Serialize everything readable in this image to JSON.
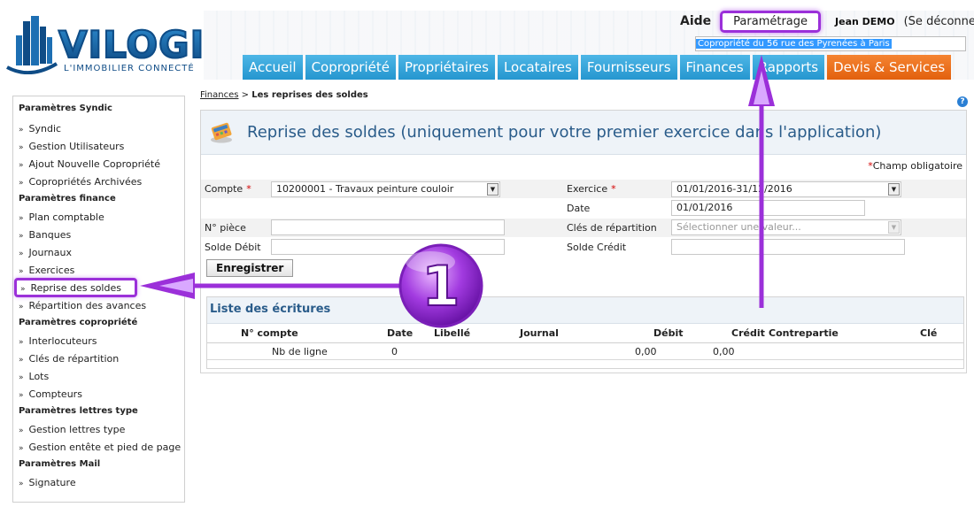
{
  "header": {
    "logo_word": "VILOGI",
    "logo_tagline": "L'IMMOBILIER CONNECTÉ",
    "help_link": "Aide",
    "settings_button": "Paramétrage",
    "user_name": "Jean DEMO",
    "logout_link": "(Se déconnecter)",
    "copro_selected": "Copropriété du 56 rue des Pyrenées à Paris"
  },
  "nav": {
    "tabs": [
      "Accueil",
      "Copropriété",
      "Propriétaires",
      "Locataires",
      "Fournisseurs",
      "Finances",
      "Rapports",
      "Devis & Services"
    ]
  },
  "sidebar": {
    "sections": [
      {
        "title": "Paramètres Syndic",
        "items": [
          "Syndic",
          "Gestion Utilisateurs",
          "Ajout Nouvelle Copropriété",
          "Copropriétés Archivées"
        ]
      },
      {
        "title": "Paramètres finance",
        "items": [
          "Plan comptable",
          "Banques",
          "Journaux",
          "Exercices",
          "Reprise des soldes",
          "Répartition des avances"
        ]
      },
      {
        "title": "Paramètres copropriété",
        "items": [
          "Interlocuteurs",
          "Clés de répartition",
          "Lots",
          "Compteurs"
        ]
      },
      {
        "title": "Paramètres lettres type",
        "items": [
          "Gestion lettres type",
          "Gestion entête et pied de page"
        ]
      },
      {
        "title": "Paramètres Mail",
        "items": [
          "Signature"
        ]
      }
    ]
  },
  "breadcrumb": {
    "parent": "Finances",
    "separator": ">",
    "current": "Les reprises des soldes"
  },
  "panel": {
    "title": "Reprise des soldes (uniquement pour votre premier exercice dans l'application)",
    "required_note": "Champ obligatoire"
  },
  "form": {
    "compte_label": "Compte",
    "compte_value": "10200001 - Travaux peinture couloir",
    "exercice_label": "Exercice",
    "exercice_value": "01/01/2016-31/12/2016",
    "date_label": "Date",
    "date_value": "01/01/2016",
    "piece_label": "N° pièce",
    "piece_value": "",
    "cles_label": "Clés de répartition",
    "cles_placeholder": "Sélectionner une valeur...",
    "debit_label": "Solde Débit",
    "debit_value": "",
    "credit_label": "Solde Crédit",
    "credit_value": "",
    "save_button": "Enregistrer"
  },
  "entries": {
    "title": "Liste des écritures",
    "columns": [
      "N° compte",
      "Date",
      "Libellé",
      "Journal",
      "Débit",
      "Crédit",
      "Contrepartie",
      "Clé"
    ],
    "summary_row": {
      "label": "Nb de ligne",
      "count": "0",
      "debit": "0,00",
      "credit": "0,00"
    }
  },
  "annotations": {
    "step_number": "1"
  },
  "colors": {
    "nav_blue": "#2596cf",
    "nav_orange": "#e2600d",
    "title_blue": "#2a5c8a",
    "highlight_purple": "#9b30d9"
  }
}
